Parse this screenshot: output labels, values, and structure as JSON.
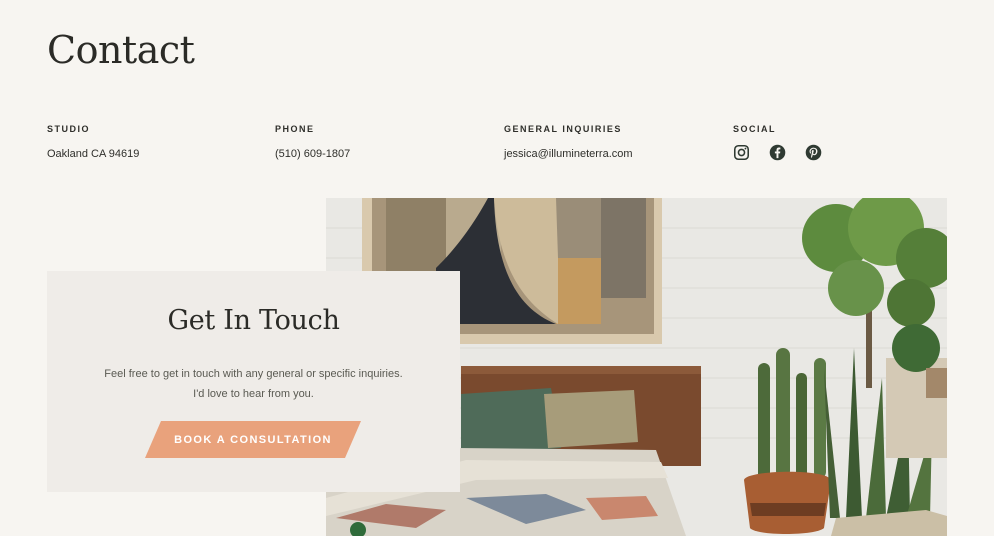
{
  "page": {
    "title": "Contact"
  },
  "contact": {
    "studio": {
      "label": "STUDIO",
      "value": "Oakland CA 94619"
    },
    "phone": {
      "label": "PHONE",
      "value": "(510) 609-1807"
    },
    "general": {
      "label": "GENERAL INQUIRIES",
      "value": "jessica@illumineterra.com"
    },
    "social": {
      "label": "SOCIAL",
      "icons": [
        "instagram-icon",
        "facebook-icon",
        "pinterest-icon"
      ]
    }
  },
  "touch": {
    "title": "Get In Touch",
    "line1": "Feel free to get in touch with any general or specific inquiries.",
    "line2": "I'd love to hear from you.",
    "button_label": "BOOK A CONSULTATION"
  },
  "colors": {
    "background": "#f7f5f1",
    "card": "#efece8",
    "accent": "#e9a27c",
    "text": "#2f2f2b"
  }
}
